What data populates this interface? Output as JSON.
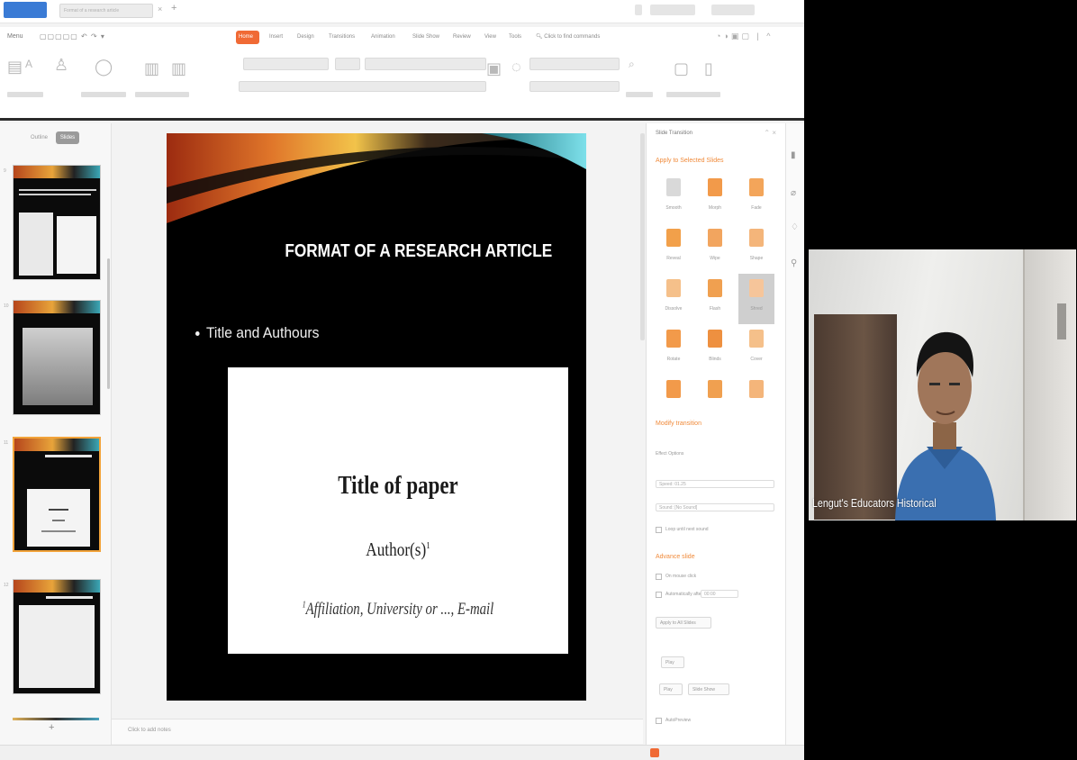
{
  "titlebar": {
    "doc_tab": "Format of a research article"
  },
  "menubar": {
    "left_label": "Menu",
    "items": [
      "Home",
      "Insert",
      "Design",
      "Transitions",
      "Animation",
      "Slide Show",
      "Review",
      "View",
      "Tools"
    ],
    "search": "Click to find commands"
  },
  "thumbs": {
    "outline_label": "Outline",
    "slides_label": "Slides",
    "numbers": [
      "9",
      "10",
      "11",
      "12"
    ]
  },
  "slide": {
    "title": "FORMAT OF A RESEARCH ARTICLE",
    "bullet": "Title and Authours",
    "paper_title": "Title of paper",
    "paper_author": "Author(s)",
    "paper_author_sup": "1",
    "paper_affil_sup": "1",
    "paper_affil": "Affiliation, University or ..., E-mail"
  },
  "notes": {
    "label": "Click to add notes"
  },
  "panel": {
    "head": "Slide Transition",
    "apply_label": "Apply to Selected Slides",
    "modify_label": "Modify transition",
    "effect_options_label": "Effect Options",
    "speed_label": "Speed: 01.25",
    "sound_label": "Sound: [No Sound]",
    "loop_label": "Loop until next sound",
    "advance_label": "Advance slide",
    "on_click_label": "On mouse click",
    "auto_label": "Automatically after",
    "auto_value": "00:00",
    "apply_all": "Apply to All Slides",
    "play_label": "Play",
    "slide_show_label": "Slide Show",
    "autopreview_label": "AutoPreview",
    "transitions": [
      {
        "label": "Smooth",
        "color": "#d9d9d9"
      },
      {
        "label": "Morph",
        "color": "#f29a4a"
      },
      {
        "label": "Fade",
        "color": "#f3a55a"
      },
      {
        "label": "Reveal",
        "color": "#f2a04a"
      },
      {
        "label": "Wipe",
        "color": "#f2a55f"
      },
      {
        "label": "Shape",
        "color": "#f4b57a"
      },
      {
        "label": "Dissolve",
        "color": "#f5c08a"
      },
      {
        "label": "Flash",
        "color": "#f0a050"
      },
      {
        "label": "Shred",
        "color": "#f6c59a"
      },
      {
        "label": "Rotate",
        "color": "#f29a4a"
      },
      {
        "label": "Blinds",
        "color": "#ee9040"
      },
      {
        "label": "Cover",
        "color": "#f5c08a"
      },
      {
        "label": "",
        "color": "#f29a4a"
      },
      {
        "label": "",
        "color": "#f0a050"
      },
      {
        "label": "",
        "color": "#f4b57a"
      }
    ]
  },
  "webcam": {
    "caption": "Lengut's Educators Historical"
  },
  "colors": {
    "accent": "#f06a35",
    "slide_bg": "#000000"
  }
}
